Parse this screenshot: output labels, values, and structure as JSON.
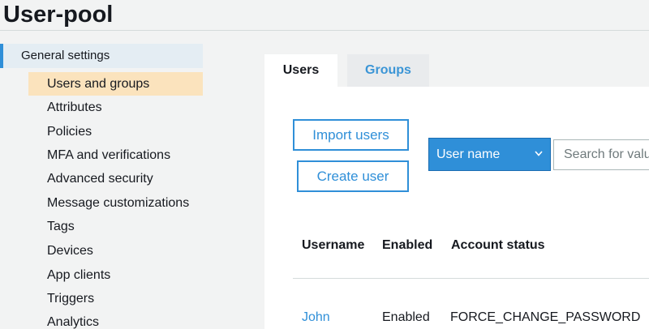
{
  "page": {
    "title": "User-pool"
  },
  "sidebar": {
    "header": "General settings",
    "items": [
      {
        "label": "Users and groups",
        "active": true
      },
      {
        "label": "Attributes"
      },
      {
        "label": "Policies"
      },
      {
        "label": "MFA and verifications"
      },
      {
        "label": "Advanced security"
      },
      {
        "label": "Message customizations"
      },
      {
        "label": "Tags"
      },
      {
        "label": "Devices"
      },
      {
        "label": "App clients"
      },
      {
        "label": "Triggers"
      },
      {
        "label": "Analytics"
      }
    ]
  },
  "tabs": [
    {
      "label": "Users",
      "active": true
    },
    {
      "label": "Groups",
      "active": false
    }
  ],
  "actions": {
    "import_label": "Import users",
    "create_label": "Create user"
  },
  "filter": {
    "selected": "User name",
    "search_placeholder": "Search for value"
  },
  "table": {
    "columns": [
      "Username",
      "Enabled",
      "Account status"
    ],
    "rows": [
      {
        "username": "John",
        "enabled": "Enabled",
        "status": "FORCE_CHANGE_PASSWORD"
      }
    ]
  },
  "colors": {
    "accent": "#2f8fd8",
    "active_item_bg": "#fbe3bd",
    "sidebar_header_bg": "#e4edf3"
  }
}
